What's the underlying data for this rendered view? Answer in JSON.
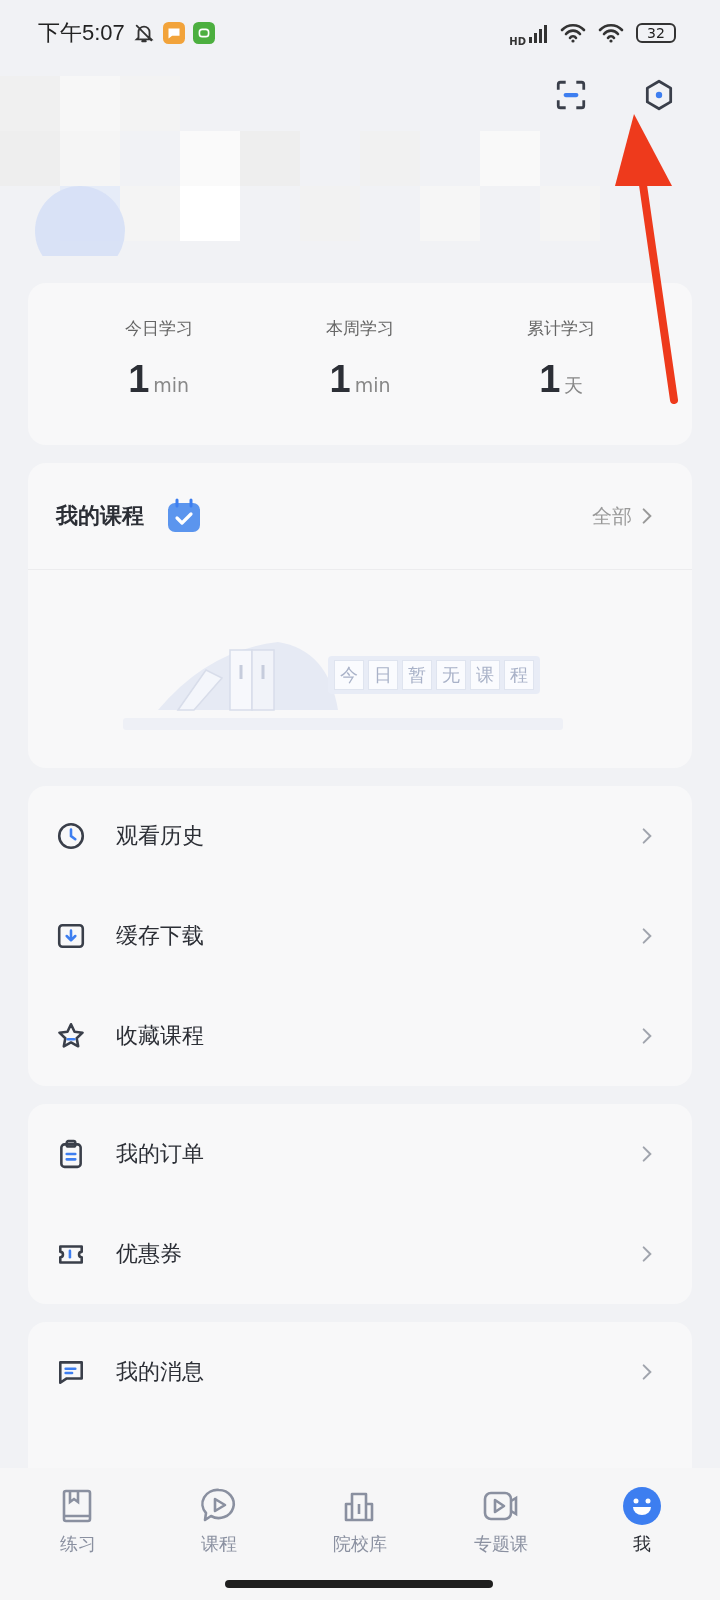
{
  "status_bar": {
    "time": "下午5:07",
    "network": "HD",
    "battery": "32"
  },
  "header": {
    "actions": [
      {
        "kind": "scan"
      },
      {
        "kind": "settings"
      }
    ]
  },
  "stats": [
    {
      "label": "今日学习",
      "value": "1",
      "unit": "min"
    },
    {
      "label": "本周学习",
      "value": "1",
      "unit": "min"
    },
    {
      "label": "累计学习",
      "value": "1",
      "unit": "天"
    }
  ],
  "my_courses": {
    "title": "我的课程",
    "link": "全部",
    "empty_text": "今日暂无课程"
  },
  "menu_groups": [
    [
      {
        "kind": "history",
        "label": "观看历史"
      },
      {
        "kind": "download",
        "label": "缓存下载"
      },
      {
        "kind": "star",
        "label": "收藏课程"
      }
    ],
    [
      {
        "kind": "clipboard",
        "label": "我的订单"
      },
      {
        "kind": "ticket",
        "label": "优惠券"
      }
    ],
    [
      {
        "kind": "message",
        "label": "我的消息"
      }
    ]
  ],
  "nav": [
    {
      "kind": "book",
      "label": "练习",
      "selected": false
    },
    {
      "kind": "play",
      "label": "课程",
      "selected": false
    },
    {
      "kind": "building",
      "label": "院校库",
      "selected": false
    },
    {
      "kind": "video",
      "label": "专题课",
      "selected": false
    },
    {
      "kind": "face",
      "label": "我",
      "selected": true
    }
  ]
}
